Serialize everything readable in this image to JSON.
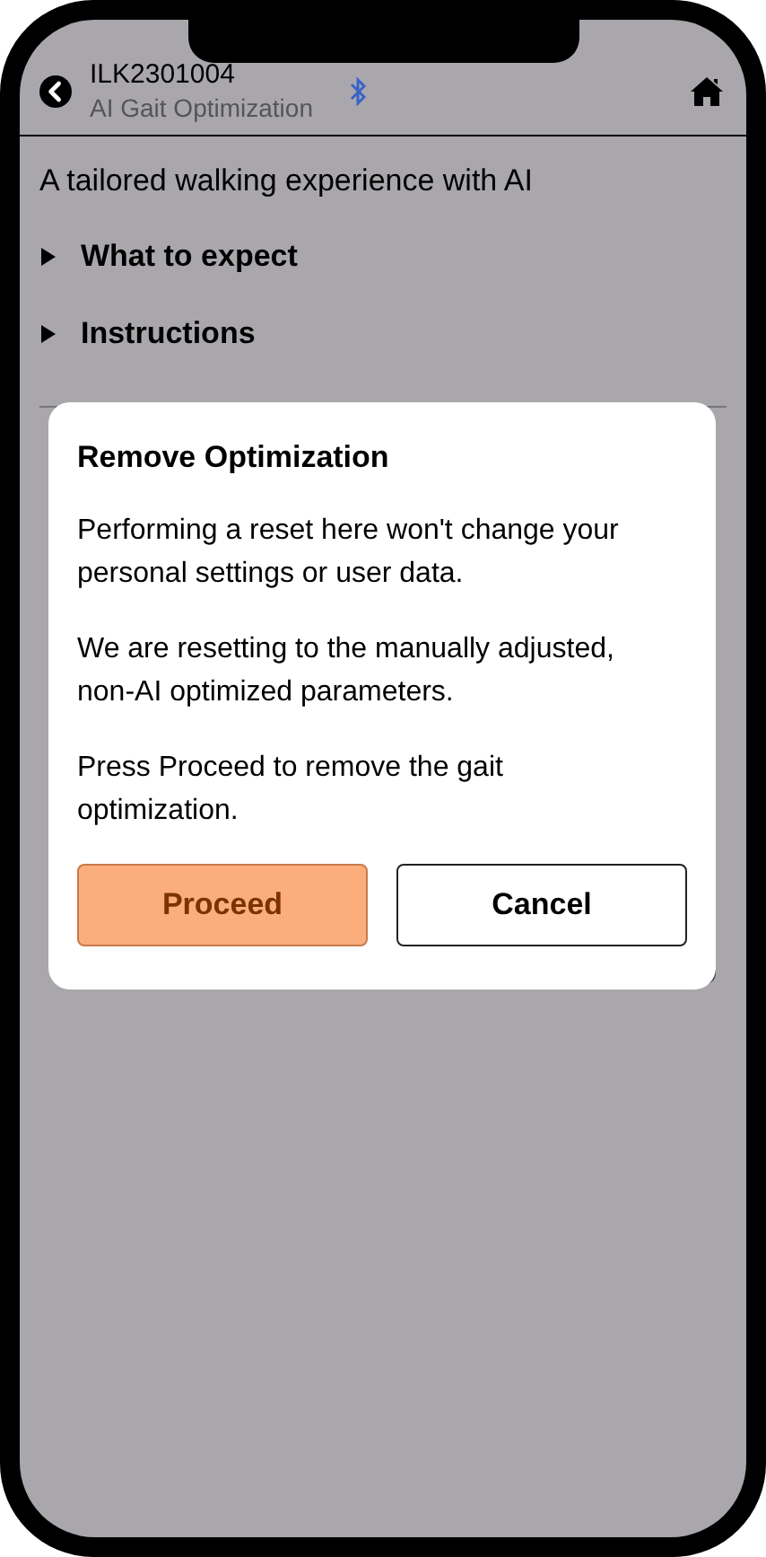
{
  "header": {
    "title": "ILK2301004",
    "subtitle": "AI Gait Optimization",
    "bluetooth_connected": true
  },
  "tagline": "A tailored walking experience with AI",
  "sections": [
    {
      "label": "What to expect",
      "expanded": false
    },
    {
      "label": "Instructions",
      "expanded": false
    }
  ],
  "dialog": {
    "title": "Remove Optimization",
    "paragraphs": [
      "Performing a reset here won't change your personal settings or user data.",
      "We are resetting to the manually adjusted, non-AI optimized parameters.",
      "Press Proceed to remove the gait optimization."
    ],
    "buttons": [
      {
        "label": "Proceed",
        "kind": "primary"
      },
      {
        "label": "Cancel",
        "kind": "secondary"
      }
    ]
  }
}
